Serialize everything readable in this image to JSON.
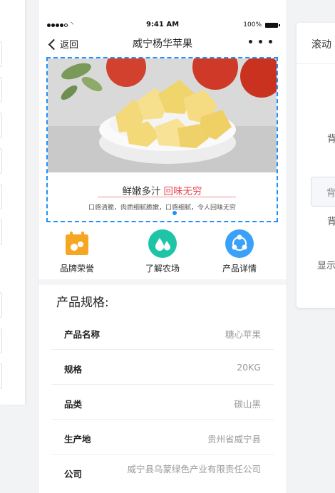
{
  "status_bar": {
    "time": "9:41 AM",
    "battery": "100%"
  },
  "nav": {
    "back_label": "返回",
    "title": "威宁杨华苹果"
  },
  "banner": {
    "caption_main": "鲜嫩多汁",
    "caption_highlight": "回味无穷",
    "subtitle": "口感清脆，肉质细腻脆嫩，口感细腻，令人回味无穷"
  },
  "entries": [
    {
      "label": "品牌荣誉",
      "icon": "calendar-badge-icon",
      "color": "#f5a623"
    },
    {
      "label": "了解农场",
      "icon": "water-drop-icon",
      "color": "#1ec4a6"
    },
    {
      "label": "产品详情",
      "icon": "molecule-icon",
      "color": "#3aa0f8"
    }
  ],
  "spec": {
    "title": "产品规格:",
    "rows": [
      {
        "key": "产品名称",
        "value": "糖心苹果"
      },
      {
        "key": "规格",
        "value": "20KG"
      },
      {
        "key": "品类",
        "value": "碳山黑"
      },
      {
        "key": "生产地",
        "value": "贵州省威宁县"
      },
      {
        "key": "公司",
        "value": "威宁县乌蒙绿色产业有限责任公司"
      }
    ]
  },
  "right_panel": {
    "title": "滚动",
    "label_1": "背",
    "input_text": "背",
    "label_2": "背",
    "label_3": "显示"
  }
}
